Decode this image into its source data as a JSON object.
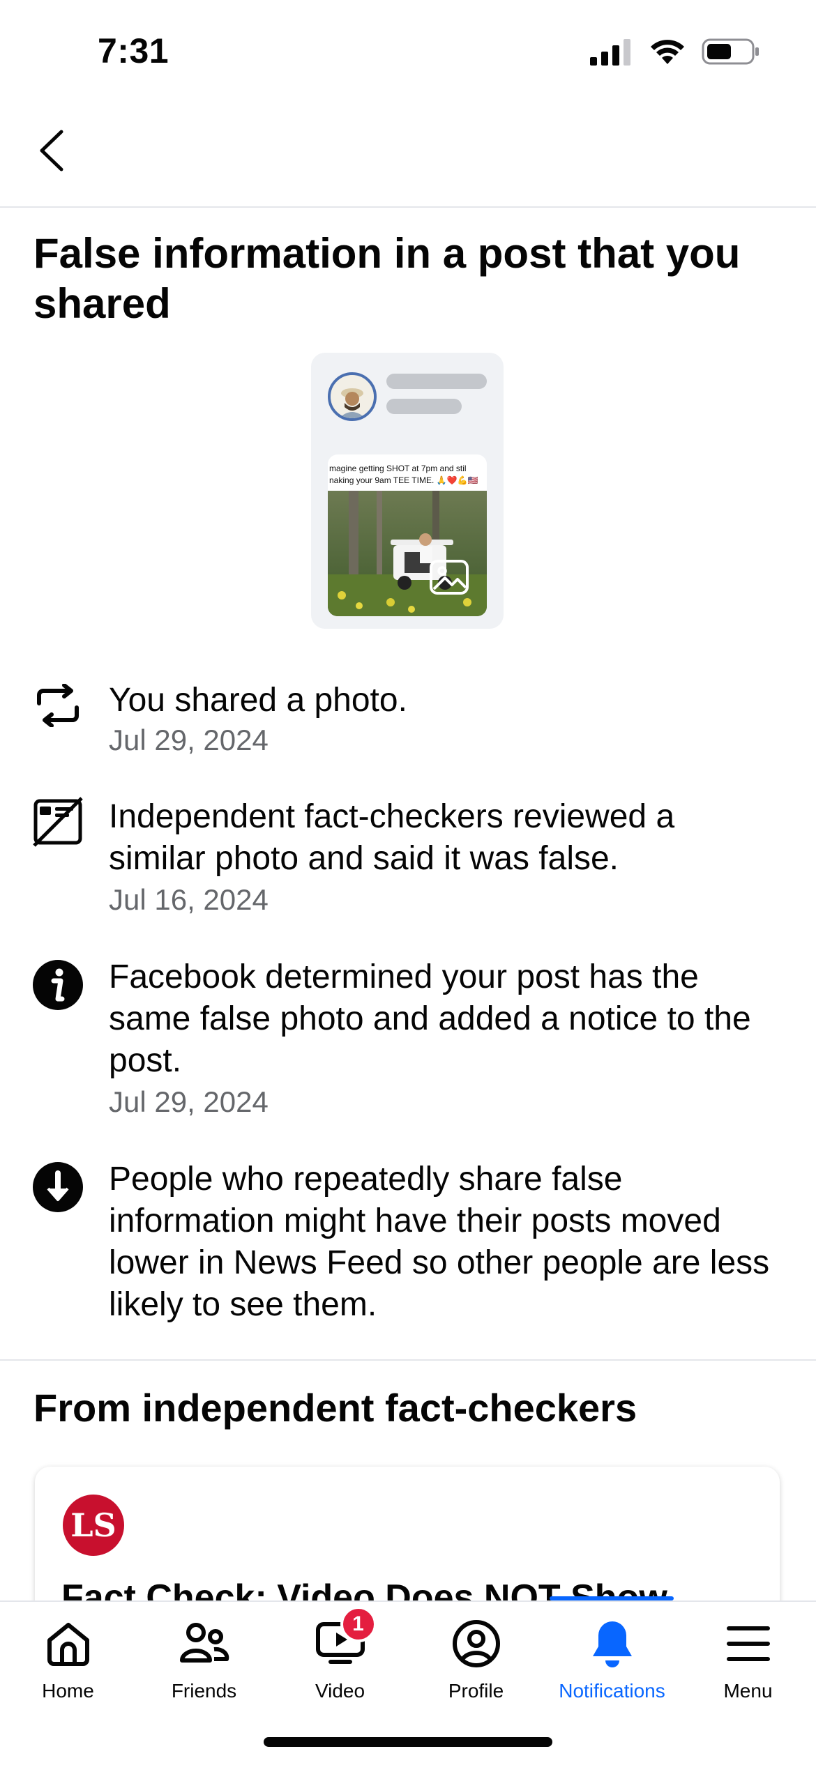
{
  "status_bar": {
    "time": "7:31",
    "icons": [
      "cellular-signal-icon",
      "wifi-icon",
      "battery-icon"
    ]
  },
  "nav": {
    "back_icon": "chevron-left-icon"
  },
  "page_title": "False information in a post that you shared",
  "preview": {
    "post_text": "magine getting SHOT at 7pm and stil\nnaking your 9am TEE TIME. 🙏❤️💪🇺🇸",
    "photo_icon": "image-icon"
  },
  "timeline": [
    {
      "icon": "share-repost-icon",
      "text": "You shared a photo.",
      "date": "Jul 29, 2024"
    },
    {
      "icon": "photo-disabled-icon",
      "text": "Independent fact-checkers reviewed a similar photo and said it was false.",
      "date": "Jul 16, 2024"
    },
    {
      "icon": "info-icon",
      "text": "Facebook determined your post has the same false photo and added a notice to the post.",
      "date": "Jul 29, 2024"
    },
    {
      "icon": "arrow-down-circle-icon",
      "text": "People who repeatedly share false information might have their posts moved lower in News Feed so other people are less likely to see them."
    }
  ],
  "fact_check_section": {
    "title": "From independent fact-checkers",
    "card": {
      "logo_text": "LS",
      "headline": "Fact Check: Video Does NOT Show"
    }
  },
  "tabbar": {
    "tabs": [
      {
        "label": "Home",
        "icon": "home-icon"
      },
      {
        "label": "Friends",
        "icon": "friends-icon"
      },
      {
        "label": "Video",
        "icon": "video-icon",
        "badge": "1"
      },
      {
        "label": "Profile",
        "icon": "profile-icon"
      },
      {
        "label": "Notifications",
        "icon": "bell-icon",
        "active": true
      },
      {
        "label": "Menu",
        "icon": "menu-icon"
      }
    ]
  },
  "colors": {
    "accent": "#0866ff",
    "text_primary": "#050505",
    "text_secondary": "#65676b",
    "badge": "#e41e3f",
    "divider": "#e4e6eb"
  }
}
